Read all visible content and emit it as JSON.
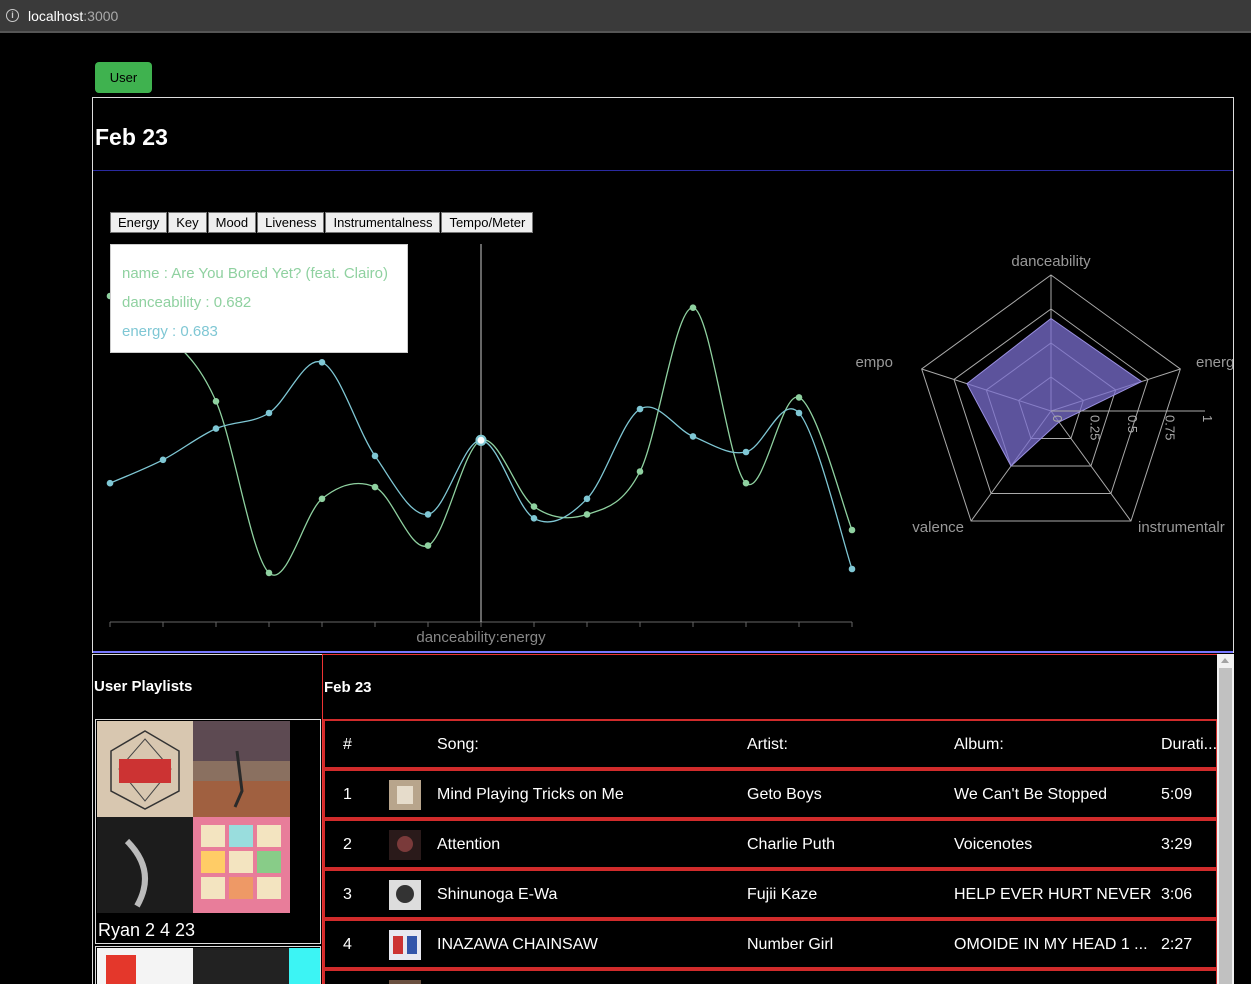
{
  "browser": {
    "host": "localhost",
    "port": ":3000"
  },
  "user_button": "User",
  "page_title": "Feb 23",
  "feature_tabs": [
    "Energy",
    "Key",
    "Mood",
    "Liveness",
    "Instrumentalness",
    "Tempo/Meter"
  ],
  "tooltip": {
    "name": "name : Are You Bored Yet? (feat. Clairo)",
    "danceability": "danceability : 0.682",
    "energy": "energy : 0.683"
  },
  "colors": {
    "danceability": "#8fd1a0",
    "energy": "#7fc7d4",
    "radar_fill": "#7b6fd0",
    "accent_green": "#3fb24f",
    "row_border": "#d12b2b"
  },
  "chart_data": [
    {
      "type": "line",
      "xlabel": "danceability:energy",
      "series": [
        {
          "name": "danceability",
          "values": [
            0.8,
            0.71,
            0.53,
            0.09,
            0.28,
            0.31,
            0.16,
            0.43,
            0.26,
            0.24,
            0.35,
            0.77,
            0.32,
            0.54,
            0.2
          ]
        },
        {
          "name": "energy",
          "values": [
            0.32,
            0.38,
            0.46,
            0.5,
            0.63,
            0.39,
            0.24,
            0.43,
            0.23,
            0.28,
            0.51,
            0.44,
            0.4,
            0.5,
            0.1
          ]
        }
      ],
      "ylim": [
        0,
        1
      ],
      "active_index": 7
    },
    {
      "type": "radar",
      "axes": [
        "danceability",
        "energ",
        "instrumentalr",
        "valence",
        "empo"
      ],
      "ticks": [
        "0",
        "0.25",
        "0.5",
        "0.75",
        "1"
      ],
      "values": [
        0.68,
        0.7,
        0.1,
        0.5,
        0.65
      ],
      "range": [
        0,
        1
      ]
    }
  ],
  "playlists": {
    "heading": "User Playlists",
    "items": [
      {
        "name": "Ryan 2 4 23"
      }
    ]
  },
  "tracks": {
    "heading": "Feb 23",
    "columns": {
      "num": "#",
      "song": "Song:",
      "artist": "Artist:",
      "album": "Album:",
      "duration": "Durati..."
    },
    "rows": [
      {
        "num": "1",
        "song": "Mind Playing Tricks on Me",
        "artist": "Geto Boys",
        "album": "We Can't Be Stopped",
        "duration": "5:09"
      },
      {
        "num": "2",
        "song": "Attention",
        "artist": "Charlie Puth",
        "album": "Voicenotes",
        "duration": "3:29"
      },
      {
        "num": "3",
        "song": "Shinunoga E-Wa",
        "artist": "Fujii Kaze",
        "album": "HELP EVER HURT NEVER",
        "duration": "3:06"
      },
      {
        "num": "4",
        "song": "INAZAWA CHAINSAW",
        "artist": "Number Girl",
        "album": "OMOIDE IN MY HEAD 1 ...",
        "duration": "2:27"
      }
    ]
  }
}
